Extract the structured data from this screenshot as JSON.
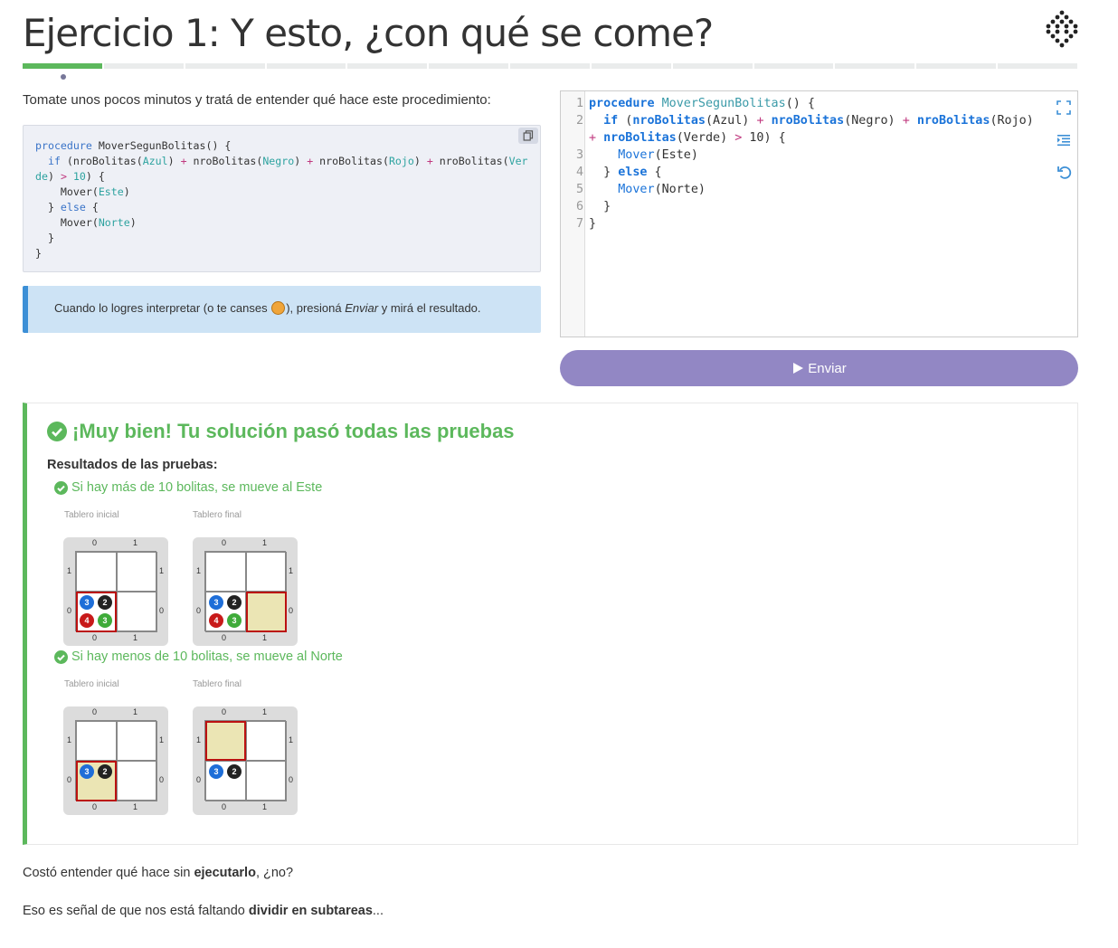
{
  "header": {
    "title": "Ejercicio 1: Y esto, ¿con qué se come?",
    "logo_icon": "gobstones-logo-icon",
    "progress": {
      "total_steps": 13,
      "completed_steps": 1,
      "current_step": 1
    }
  },
  "intro": {
    "text": "Tomate unos pocos minutos y tratá de entender qué hace este procedimiento:"
  },
  "code_sample": {
    "copy_icon": "copy-icon",
    "lines": [
      "procedure MoverSegunBolitas() {",
      "  if (nroBolitas(Azul) + nroBolitas(Negro) + nroBolitas(Rojo) + nroBolitas(Ver",
      "de)) > 10) {",
      "    Mover(Este)",
      "  } else {",
      "    Mover(Norte)",
      "  }",
      "}"
    ]
  },
  "hint": {
    "before": "Cuando lo logres interpretar (o te canses ",
    "emoji": "tongue-emoji",
    "middle": "), presioná ",
    "emphasis": "Enviar",
    "after": " y mirá el resultado."
  },
  "editor": {
    "line_numbers": [
      "1",
      "2",
      "3",
      "4",
      "5",
      "6",
      "7"
    ],
    "lines": [
      "procedure MoverSegunBolitas() {",
      "  if (nroBolitas(Azul) + nroBolitas(Negro) + nroBolitas(Rojo)",
      "+ nroBolitas(Verde) > 10) {",
      "    Mover(Este)",
      "  } else {",
      "    Mover(Norte)",
      "  }",
      "}"
    ],
    "icons": [
      "fullscreen-icon",
      "indent-icon",
      "reset-icon"
    ]
  },
  "submit": {
    "label": "Enviar",
    "icon": "play-icon"
  },
  "result": {
    "title": "¡Muy bien! Tu solución pasó todas las pruebas",
    "subtitle": "Resultados de las pruebas:",
    "status_color": "#5cb85c",
    "tests": [
      {
        "title": "Si hay más de 10 bolitas, se mueve al Este",
        "initial_label": "Tablero inicial",
        "final_label": "Tablero final",
        "initial_head": [
          0,
          0
        ],
        "final_head": [
          1,
          0
        ],
        "balls_at_0_0": {
          "azul": "3",
          "negro": "2",
          "rojo": "4",
          "verde": "3"
        }
      },
      {
        "title": "Si hay menos de 10 bolitas, se mueve al Norte",
        "initial_label": "Tablero inicial",
        "final_label": "Tablero final",
        "initial_head": [
          0,
          0
        ],
        "final_head": [
          0,
          1
        ],
        "balls_at_0_0": {
          "azul": "3",
          "negro": "2"
        }
      }
    ],
    "axis": {
      "x": [
        "0",
        "1"
      ],
      "y": [
        "1",
        "0"
      ]
    }
  },
  "footer": {
    "p1_before": "Costó entender qué hace sin ",
    "p1_bold": "ejecutarlo",
    "p1_after": ", ¿no?",
    "p2_before": "Eso es señal de que nos está faltando ",
    "p2_bold": "dividir en subtareas",
    "p2_after": "..."
  }
}
